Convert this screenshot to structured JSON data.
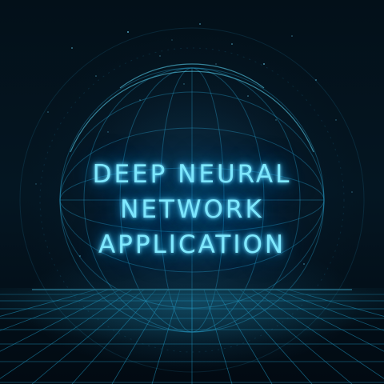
{
  "title": {
    "lines": [
      "DEEP NEURAL",
      "NETWORK",
      "APPLICATION"
    ]
  },
  "colors": {
    "background": "#020a12",
    "glow_text": "#7fe9ff",
    "accent_cyan": "#2bc6ff",
    "grid_line": "#1e8fb8"
  },
  "decor": {
    "sphere": "glowing-wireframe-sphere",
    "floor": "perspective-grid-floor",
    "particles": "scattered-light-dots"
  }
}
